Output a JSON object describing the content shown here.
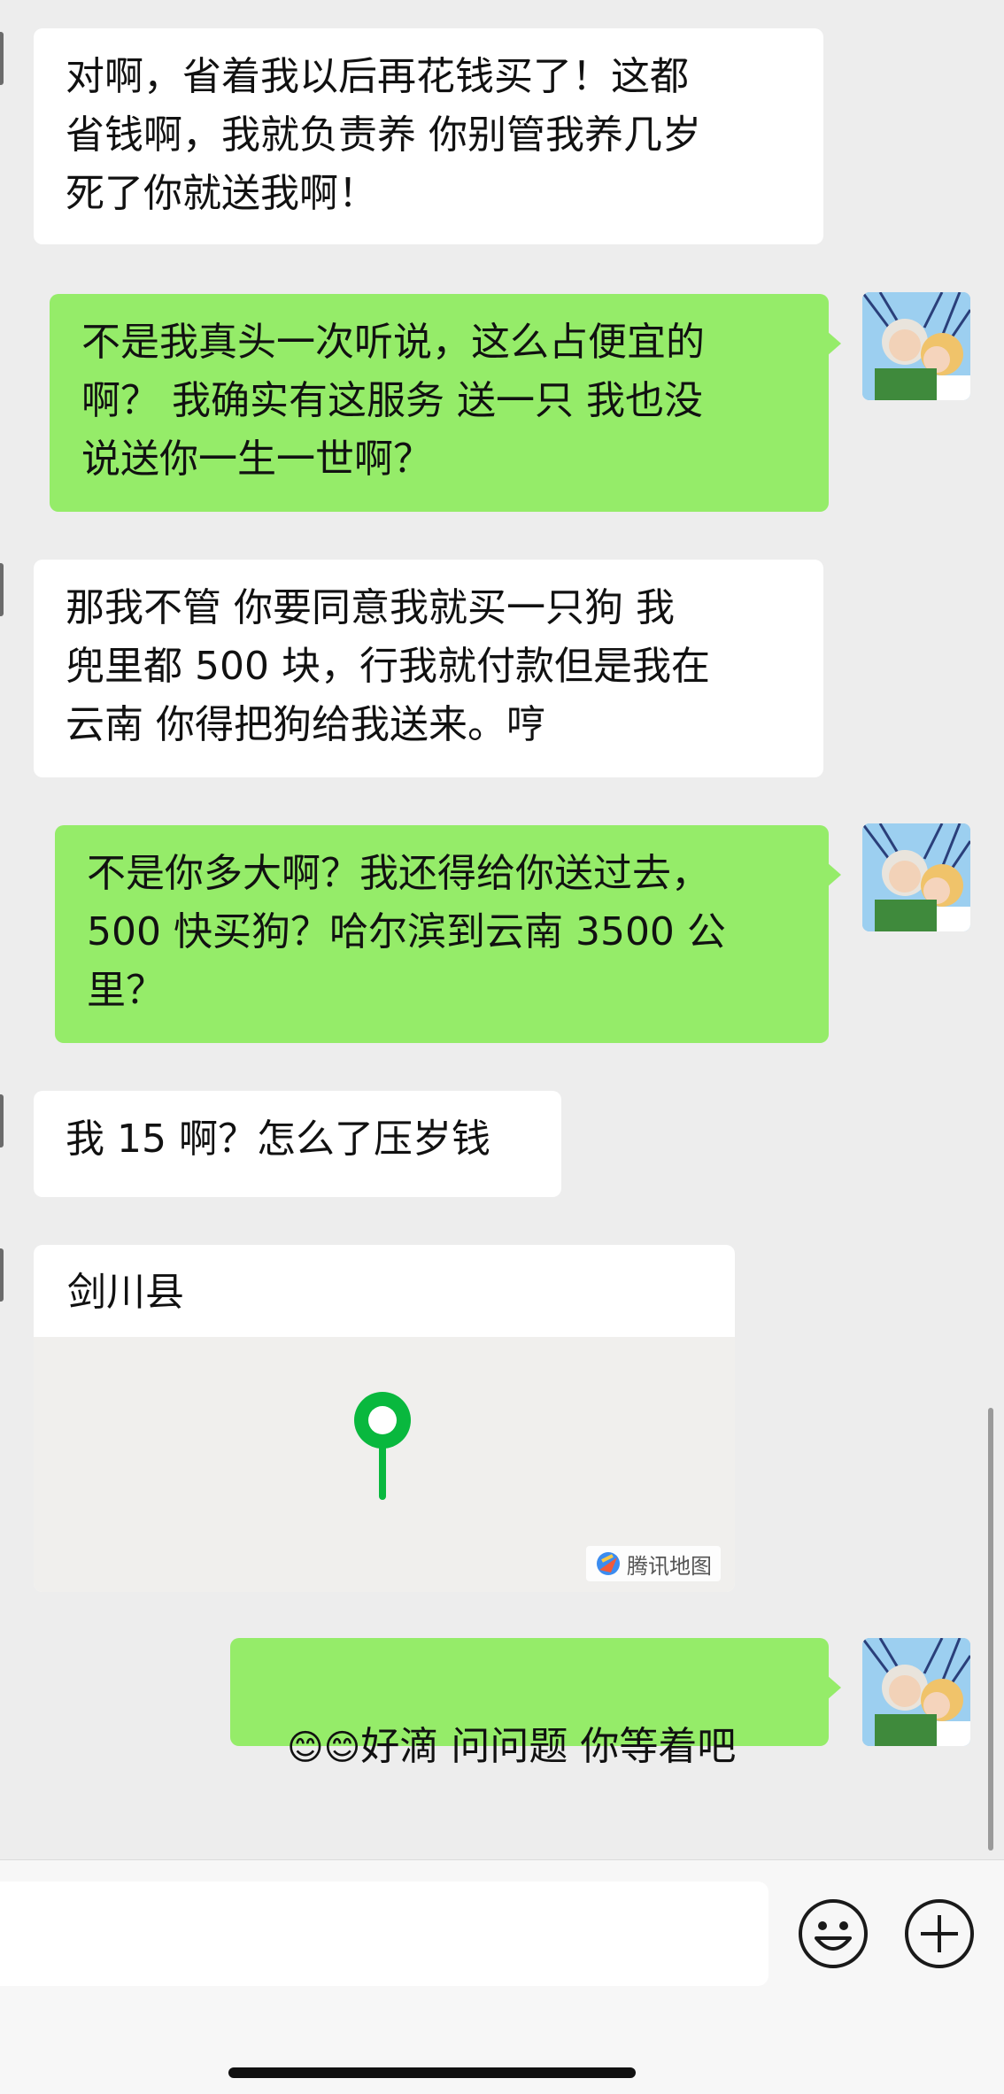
{
  "messages": [
    {
      "side": "in",
      "text": "对啊，省着我以后再花钱买了！这都\n省钱啊，我就负责养 你别管我养几岁\n死了你就送我啊！"
    },
    {
      "side": "out",
      "text": "不是我真头一次听说，这么占便宜的\n啊？ 我确实有这服务 送一只 我也没\n说送你一生一世啊？"
    },
    {
      "side": "in",
      "text": "那我不管 你要同意我就买一只狗 我\n兜里都 500 块，行我就付款但是我在\n云南 你得把狗给我送来。哼"
    },
    {
      "side": "out",
      "text": "不是你多大啊？我还得给你送过去，\n500 快买狗？哈尔滨到云南 3500 公\n里？"
    },
    {
      "side": "in",
      "text": "我 15 啊？怎么了压岁钱"
    },
    {
      "side": "out",
      "text": "好滴 问问题 你等着吧",
      "emoji": "😊😊"
    }
  ],
  "location": {
    "title": "剑川县",
    "map_credit": "腾讯地图"
  },
  "input": {
    "placeholder": ""
  },
  "colors": {
    "out_bubble": "#95ec69",
    "in_bubble": "#ffffff",
    "pin": "#09b83e"
  },
  "icons": {
    "emoji_button": "emoji-face-icon",
    "add_button": "plus-circle-icon"
  }
}
